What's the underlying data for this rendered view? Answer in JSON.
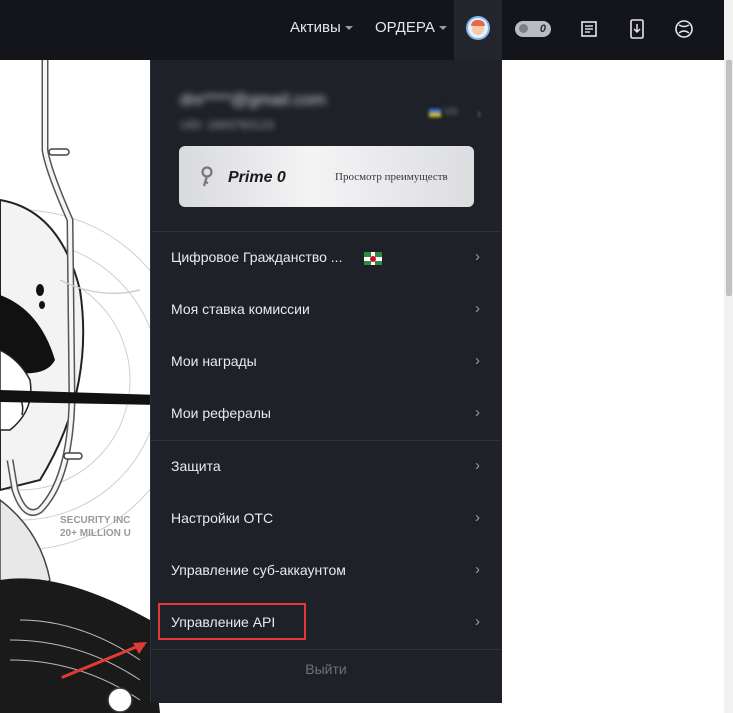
{
  "header": {
    "nav": [
      {
        "label": "Активы"
      },
      {
        "label": "ОРДЕРА"
      }
    ],
    "prime_badge": "0"
  },
  "dropdown": {
    "email": "dnr****@gmail.com",
    "uid": "UID: 1693783123",
    "vip": "V0",
    "prime_card": {
      "title": "Prime 0",
      "link": "Просмотр преимуществ"
    },
    "menu": [
      {
        "label": "Цифровое Гражданство ..."
      },
      {
        "label": "Моя ставка комиссии"
      },
      {
        "label": "Мои награды"
      },
      {
        "label": "Мои рефералы"
      },
      {
        "label": "Защита"
      },
      {
        "label": "Настройки OTC"
      },
      {
        "label": "Управление суб-аккаунтом"
      },
      {
        "label": "Управление API"
      }
    ],
    "logout": "Выйти"
  },
  "background_art": {
    "caption_line1": "SECURITY INC",
    "caption_line2": "20+ MILLION U"
  },
  "colors": {
    "header_bg": "#14151a",
    "dropdown_bg": "#1f2128",
    "highlight": "#e03b35"
  }
}
